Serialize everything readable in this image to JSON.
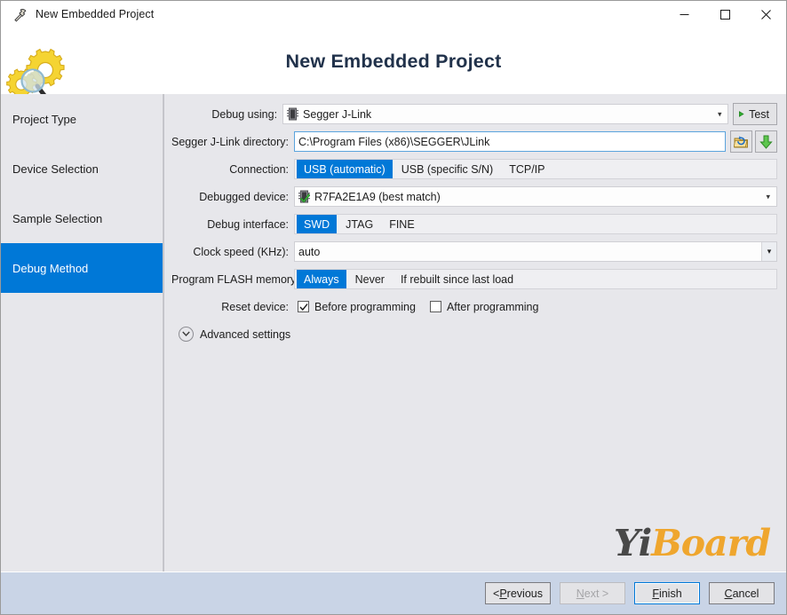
{
  "window": {
    "title": "New Embedded Project",
    "titlebar_icon": "hammer-icon",
    "controls": {
      "minimize": "minimize-icon",
      "maximize": "maximize-icon",
      "close": "close-icon"
    }
  },
  "banner": {
    "title": "New Embedded Project",
    "icon": "gears-magnifier-icon"
  },
  "sidebar": {
    "items": [
      {
        "label": "Project Type",
        "active": false
      },
      {
        "label": "Device Selection",
        "active": false
      },
      {
        "label": "Sample Selection",
        "active": false
      },
      {
        "label": "Debug Method",
        "active": true
      }
    ]
  },
  "form": {
    "debug_using": {
      "label": "Debug using:",
      "value": "Segger J-Link",
      "icon": "chip-icon",
      "test_button": "Test"
    },
    "directory": {
      "label": "Segger J-Link directory:",
      "value": "C:\\Program Files (x86)\\SEGGER\\JLink",
      "browse_icon": "folder-refresh-icon",
      "download_icon": "green-download-arrow-icon"
    },
    "connection": {
      "label": "Connection:",
      "options": [
        "USB (automatic)",
        "USB (specific S/N)",
        "TCP/IP"
      ],
      "selected": "USB (automatic)"
    },
    "debugged_device": {
      "label": "Debugged device:",
      "value": "R7FA2E1A9 (best match)",
      "icon": "chip-check-icon"
    },
    "debug_interface": {
      "label": "Debug interface:",
      "options": [
        "SWD",
        "JTAG",
        "FINE"
      ],
      "selected": "SWD"
    },
    "clock_speed": {
      "label": "Clock speed (KHz):",
      "value": "auto"
    },
    "program_flash": {
      "label": "Program FLASH memory:",
      "options": [
        "Always",
        "Never",
        "If rebuilt since last load"
      ],
      "selected": "Always"
    },
    "reset_device": {
      "label": "Reset device:",
      "checkboxes": [
        {
          "label": "Before programming",
          "checked": true
        },
        {
          "label": "After programming",
          "checked": false
        }
      ]
    },
    "advanced": {
      "label": "Advanced settings",
      "icon": "chevron-down-circle-icon",
      "expanded": false
    }
  },
  "watermark": {
    "part1": "Yi",
    "part2": "Board"
  },
  "footer": {
    "buttons": [
      {
        "name": "previous",
        "pre": "< ",
        "acc": "P",
        "post": "revious",
        "disabled": false,
        "default": false
      },
      {
        "name": "next",
        "pre": "",
        "acc": "N",
        "post": "ext >",
        "disabled": true,
        "default": false
      },
      {
        "name": "finish",
        "pre": "",
        "acc": "F",
        "post": "inish",
        "disabled": false,
        "default": true
      },
      {
        "name": "cancel",
        "pre": "",
        "acc": "C",
        "post": "ancel",
        "disabled": false,
        "default": false
      }
    ]
  },
  "colors": {
    "accent": "#0078d7",
    "panel": "#e7e7eb",
    "footer": "#c9d4e6",
    "title_text": "#21324b",
    "watermark_gold": "#f0a11e"
  }
}
